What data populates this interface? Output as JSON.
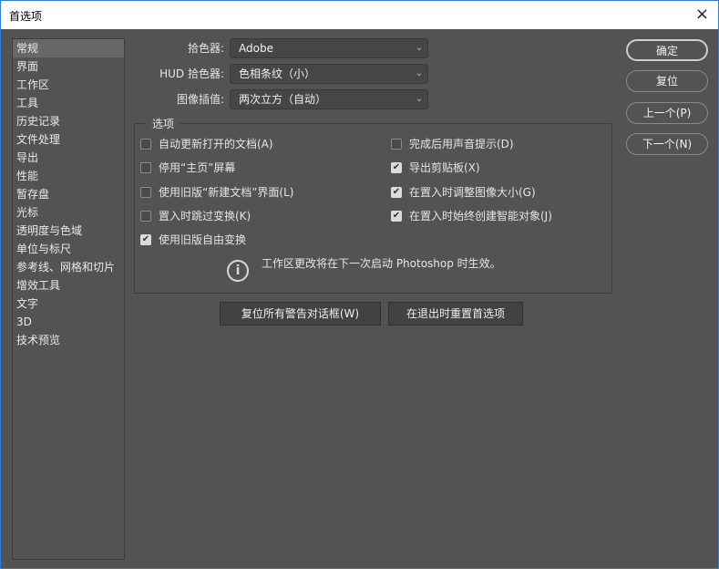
{
  "title": "首选项",
  "sidebar": {
    "items": [
      "常规",
      "界面",
      "工作区",
      "工具",
      "历史记录",
      "文件处理",
      "导出",
      "性能",
      "暂存盘",
      "光标",
      "透明度与色域",
      "单位与标尺",
      "参考线、网格和切片",
      "增效工具",
      "文字",
      "3D",
      "技术预览"
    ],
    "selected": "常规"
  },
  "fields": [
    {
      "label": "拾色器:",
      "value": "Adobe"
    },
    {
      "label": "HUD 拾色器:",
      "value": "色相条纹（小）"
    },
    {
      "label": "图像插值:",
      "value": "两次立方（自动）"
    }
  ],
  "options": {
    "legend": "选项",
    "left": [
      {
        "label": "自动更新打开的文档(A)",
        "checked": false
      },
      {
        "label": "停用“主页”屏幕",
        "checked": false
      },
      {
        "label": "使用旧版“新建文档”界面(L)",
        "checked": false
      },
      {
        "label": "置入时跳过变换(K)",
        "checked": false
      },
      {
        "label": "使用旧版自由变换",
        "checked": true
      }
    ],
    "right": [
      {
        "label": "完成后用声音提示(D)",
        "checked": false
      },
      {
        "label": "导出剪贴板(X)",
        "checked": true
      },
      {
        "label": "在置入时调整图像大小(G)",
        "checked": true
      },
      {
        "label": "在置入时始终创建智能对象(J)",
        "checked": true
      }
    ],
    "info": "工作区更改将在下一次启动 Photoshop 时生效。"
  },
  "buttons": {
    "reset_warnings": "复位所有警告对话框(W)",
    "reset_on_quit": "在退出时重置首选项",
    "ok": "确定",
    "reset": "复位",
    "prev": "上一个(P)",
    "next": "下一个(N)"
  },
  "icons": {
    "close": "×",
    "chevron": "⌄",
    "check": "✔",
    "info": "i"
  }
}
